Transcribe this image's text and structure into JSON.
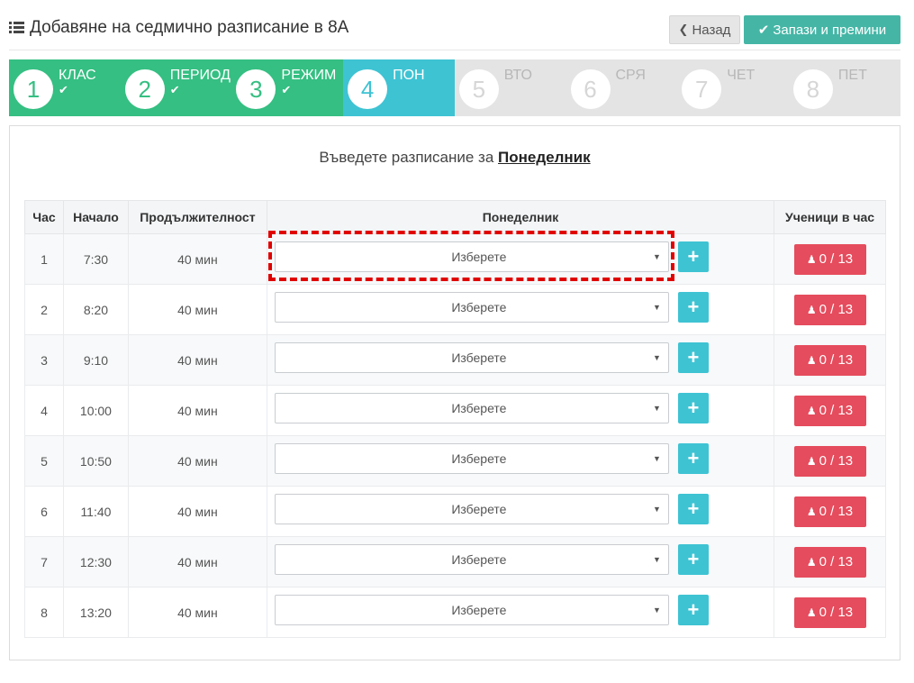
{
  "header": {
    "title": "Добавяне на седмично разписание в 8А",
    "back_label": "Назад",
    "save_label": "Запази и премини"
  },
  "steps": [
    {
      "num": "1",
      "label": "КЛАС",
      "state": "done"
    },
    {
      "num": "2",
      "label": "ПЕРИОД",
      "state": "done"
    },
    {
      "num": "3",
      "label": "РЕЖИМ",
      "state": "done"
    },
    {
      "num": "4",
      "label": "ПОН",
      "state": "active"
    },
    {
      "num": "5",
      "label": "ВТО",
      "state": "todo"
    },
    {
      "num": "6",
      "label": "СРЯ",
      "state": "todo"
    },
    {
      "num": "7",
      "label": "ЧЕТ",
      "state": "todo"
    },
    {
      "num": "8",
      "label": "ПЕТ",
      "state": "todo"
    }
  ],
  "instruction": {
    "prefix": "Въведете разписание за",
    "day": "Понеделник"
  },
  "table": {
    "headers": {
      "hour": "Час",
      "start": "Начало",
      "duration": "Продължителност",
      "day": "Понеделник",
      "students": "Ученици в час"
    },
    "select_placeholder": "Изберете",
    "rows": [
      {
        "hour": "1",
        "start": "7:30",
        "duration": "40 мин",
        "students": "0 / 13"
      },
      {
        "hour": "2",
        "start": "8:20",
        "duration": "40 мин",
        "students": "0 / 13"
      },
      {
        "hour": "3",
        "start": "9:10",
        "duration": "40 мин",
        "students": "0 / 13"
      },
      {
        "hour": "4",
        "start": "10:00",
        "duration": "40 мин",
        "students": "0 / 13"
      },
      {
        "hour": "5",
        "start": "10:50",
        "duration": "40 мин",
        "students": "0 / 13"
      },
      {
        "hour": "6",
        "start": "11:40",
        "duration": "40 мин",
        "students": "0 / 13"
      },
      {
        "hour": "7",
        "start": "12:30",
        "duration": "40 мин",
        "students": "0 / 13"
      },
      {
        "hour": "8",
        "start": "13:20",
        "duration": "40 мин",
        "students": "0 / 13"
      }
    ]
  },
  "icons": {
    "title": "list-icon",
    "back": "chevron-left-icon",
    "save": "check-icon",
    "add": "plus-icon",
    "students": "person-icon",
    "select": "caret-down-icon"
  },
  "colors": {
    "step_done": "#35bf82",
    "step_active": "#3ec3d3",
    "step_todo": "#e4e4e4",
    "save_button": "#45b6a6",
    "students_button": "#e54c5d",
    "highlight": "#e00000"
  }
}
